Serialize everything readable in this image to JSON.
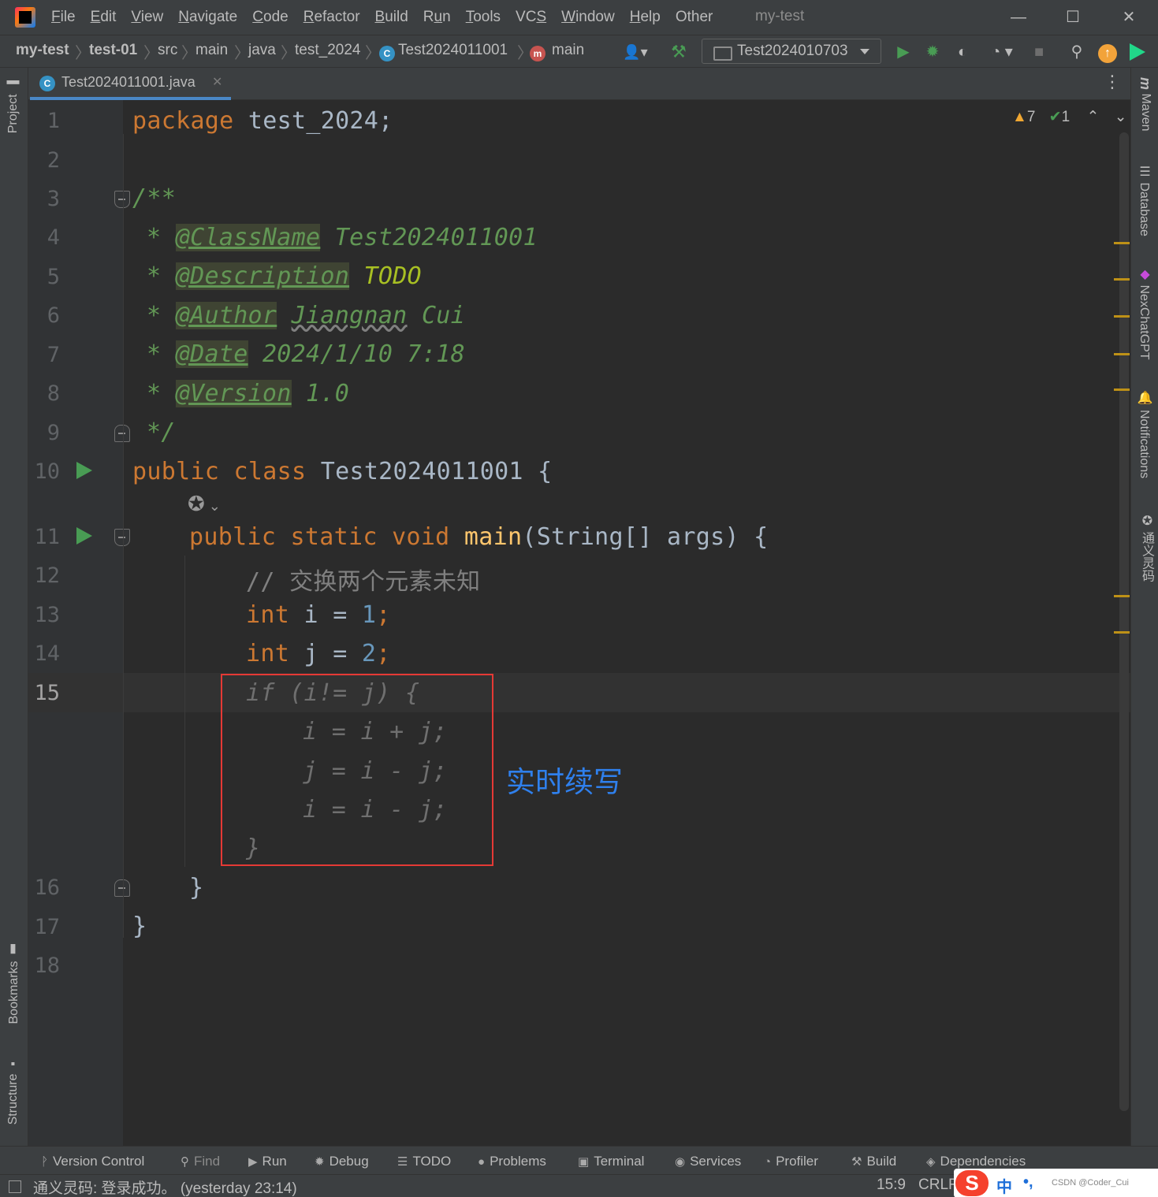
{
  "menubar": {
    "items": [
      {
        "pre": "",
        "mn": "F",
        "post": "ile"
      },
      {
        "pre": "",
        "mn": "E",
        "post": "dit"
      },
      {
        "pre": "",
        "mn": "V",
        "post": "iew"
      },
      {
        "pre": "",
        "mn": "N",
        "post": "avigate"
      },
      {
        "pre": "",
        "mn": "C",
        "post": "ode"
      },
      {
        "pre": "",
        "mn": "R",
        "post": "efactor"
      },
      {
        "pre": "",
        "mn": "B",
        "post": "uild"
      },
      {
        "pre": "R",
        "mn": "u",
        "post": "n"
      },
      {
        "pre": "",
        "mn": "T",
        "post": "ools"
      },
      {
        "pre": "VC",
        "mn": "S",
        "post": ""
      },
      {
        "pre": "",
        "mn": "W",
        "post": "indow"
      },
      {
        "pre": "",
        "mn": "H",
        "post": "elp"
      },
      {
        "pre": "Other",
        "mn": "",
        "post": ""
      }
    ],
    "project_title": "my-test"
  },
  "breadcrumb": {
    "items": [
      "my-test",
      "test-01",
      "src",
      "main",
      "java",
      "test_2024",
      "Test2024011001",
      "main"
    ]
  },
  "toolbar": {
    "run_config": "Test2024010703"
  },
  "editor_tab": {
    "filename": "Test2024011001.java",
    "class_icon": "C"
  },
  "inspection": {
    "warnings": "7",
    "checks": "1"
  },
  "code": {
    "line_numbers": [
      "1",
      "2",
      "3",
      "4",
      "5",
      "6",
      "7",
      "8",
      "9",
      "10",
      "11",
      "12",
      "13",
      "14",
      "15",
      "16",
      "17",
      "18"
    ],
    "package_kw": "package",
    "package_name": "test_2024;",
    "doc_open": "/**",
    "doc_star": "*",
    "doc_classname_tag": "@ClassName",
    "doc_classname_val": "Test2024011001",
    "doc_desc_tag": "@Description",
    "doc_desc_val": "TODO",
    "doc_author_tag": "@Author",
    "doc_author_first": "Jiangnan",
    "doc_author_last": "Cui",
    "doc_date_tag": "@Date",
    "doc_date_val": "2024/1/10 7:18",
    "doc_version_tag": "@Version",
    "doc_version_val": "1.0",
    "doc_close": "*/",
    "class_line": {
      "kw1": "public",
      "kw2": "class",
      "name": "Test2024011001 {"
    },
    "main_line": {
      "kw1": "public",
      "kw2": "static",
      "kw3": "void",
      "fn": "main",
      "args": "(String[] args) {"
    },
    "comment": "// 交换两个元素未知",
    "int_kw": "int",
    "line13": {
      "var": "i = ",
      "num": "1",
      "end": ";"
    },
    "line14": {
      "var": "j = ",
      "num": "2",
      "end": ";"
    },
    "ghost_lines": [
      "if (i!= j) {",
      "i = i + j;",
      "j = i - j;",
      "i = i - j;",
      "}"
    ],
    "close_method": "}",
    "close_class": "}"
  },
  "annotation": "实时续写",
  "right_tools": [
    "Maven",
    "Database",
    "NexChatGPT",
    "Notifications",
    "通义灵码"
  ],
  "left_tools": [
    "Project",
    "Bookmarks",
    "Structure"
  ],
  "bottom_tools": [
    {
      "icon": "branch-icon",
      "glyph": "ᚹ",
      "label": "Version Control"
    },
    {
      "icon": "search-icon",
      "glyph": "⚲",
      "label": "Find"
    },
    {
      "icon": "run-icon",
      "glyph": "▶",
      "label": "Run"
    },
    {
      "icon": "bug-icon",
      "glyph": "✹",
      "label": "Debug"
    },
    {
      "icon": "list-icon",
      "glyph": "☰",
      "label": "TODO"
    },
    {
      "icon": "problems-icon",
      "glyph": "●",
      "label": "Problems"
    },
    {
      "icon": "terminal-icon",
      "glyph": "▣",
      "label": "Terminal"
    },
    {
      "icon": "services-icon",
      "glyph": "◉",
      "label": "Services"
    },
    {
      "icon": "profiler-icon",
      "glyph": "◔",
      "label": "Profiler"
    },
    {
      "icon": "hammer-icon",
      "glyph": "⚒",
      "label": "Build"
    },
    {
      "icon": "layers-icon",
      "glyph": "◈",
      "label": "Dependencies"
    }
  ],
  "status": {
    "message": "通义灵码: 登录成功。 (yesterday 23:14)",
    "position": "15:9",
    "line_ending": "CRLF",
    "ime_label": "中",
    "watermark": "CSDN @Coder_Cui"
  },
  "colors": {
    "accent": "#4a88c7",
    "keyword": "#cc7832",
    "doc": "#629755",
    "number": "#6897bb",
    "annotation": "#2f80ed",
    "box": "#e53935"
  }
}
